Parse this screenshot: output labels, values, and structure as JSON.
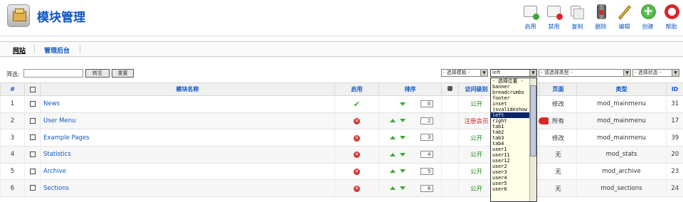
{
  "header": {
    "title": "模块管理",
    "toolbar": [
      {
        "label": "启用",
        "icon": "enable-icon"
      },
      {
        "label": "禁用",
        "icon": "disable-icon"
      },
      {
        "label": "复制",
        "icon": "copy-icon"
      },
      {
        "label": "删除",
        "icon": "delete-icon"
      },
      {
        "label": "编辑",
        "icon": "edit-icon"
      },
      {
        "label": "创建",
        "icon": "new-icon"
      },
      {
        "label": "帮助",
        "icon": "help-icon"
      }
    ]
  },
  "submenu": {
    "site": "网站",
    "admin": "管理后台"
  },
  "filter": {
    "label": "筛选:",
    "value": "",
    "go": "转至",
    "reset": "重置",
    "template_select": "- 选择模板 -",
    "position_select": "left",
    "type_select": "- 请选择类型 -",
    "state_select": "- 选择状态 -"
  },
  "table": {
    "headers": {
      "num": "#",
      "name": "模块名称",
      "enabled": "启用",
      "order": "排序",
      "access": "访问级别",
      "pages": "页面",
      "type": "类型",
      "id": "ID"
    },
    "rows": [
      {
        "num": "1",
        "name": "News",
        "enabled": true,
        "up": false,
        "down": true,
        "order": "0",
        "access": "公开",
        "access_kind": "public",
        "pages": "修改",
        "type": "mod_mainmenu",
        "id": "31"
      },
      {
        "num": "2",
        "name": "User Menu",
        "enabled": false,
        "up": true,
        "down": true,
        "order": "2",
        "access": "注册会员",
        "access_kind": "registered",
        "pages": "所有",
        "type": "mod_mainmenu",
        "id": "17"
      },
      {
        "num": "3",
        "name": "Example Pages",
        "enabled": false,
        "up": true,
        "down": true,
        "order": "3",
        "access": "公开",
        "access_kind": "public",
        "pages": "修改",
        "type": "mod_mainmenu",
        "id": "39"
      },
      {
        "num": "4",
        "name": "Statistics",
        "enabled": false,
        "up": true,
        "down": true,
        "order": "4",
        "access": "公开",
        "access_kind": "public",
        "pages": "无",
        "type": "mod_stats",
        "id": "20"
      },
      {
        "num": "5",
        "name": "Archive",
        "enabled": false,
        "up": true,
        "down": true,
        "order": "5",
        "access": "公开",
        "access_kind": "public",
        "pages": "无",
        "type": "mod_archive",
        "id": "23"
      },
      {
        "num": "6",
        "name": "Sections",
        "enabled": false,
        "up": true,
        "down": true,
        "order": "6",
        "access": "公开",
        "access_kind": "public",
        "pages": "无",
        "type": "mod_sections",
        "id": "24"
      }
    ]
  },
  "position_dropdown": {
    "options": [
      "- 选择位置 -",
      "banner",
      "breadcrumbs",
      "footer",
      "inset",
      "jsvalideshow",
      "left",
      "right",
      "tab1",
      "tab2",
      "tab3",
      "tab4",
      "user1",
      "user11",
      "user12",
      "user2",
      "user3",
      "user4",
      "user5",
      "user6"
    ],
    "selected": "left"
  },
  "colors": {
    "link": "#0b55c4",
    "public": "#1a8a1a",
    "registered": "#d9262b",
    "selected_bg": "#0a246a",
    "dropdown_bg": "#ffffe8"
  }
}
